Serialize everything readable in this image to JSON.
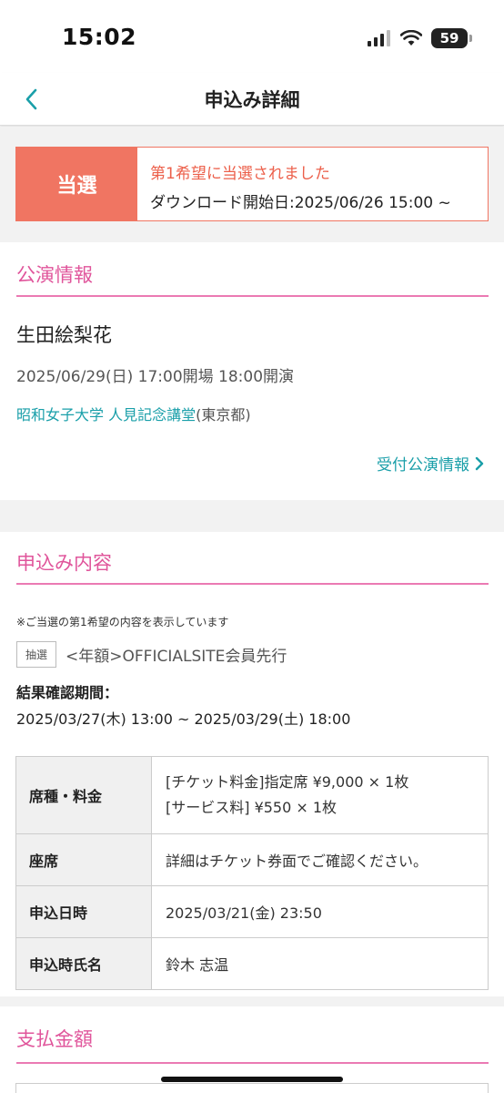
{
  "status_bar": {
    "time": "15:02",
    "battery": "59"
  },
  "nav": {
    "title": "申込み詳細"
  },
  "result": {
    "badge": "当選",
    "headline": "第1希望に当選されました",
    "download": "ダウンロード開始日:2025/06/26 15:00 ~"
  },
  "performance": {
    "section_title": "公演情報",
    "artist": "生田絵梨花",
    "datetime": "2025/06/29(日) 17:00開場 18:00開演",
    "venue": "昭和女子大学 人見記念講堂",
    "prefecture": "(東京都)",
    "more_link": "受付公演情報"
  },
  "application": {
    "section_title": "申込み内容",
    "note": "※ご当選の第1希望の内容を表示しています",
    "tag": "抽選",
    "sale_name": "<年額>OFFICIALSITE会員先行",
    "period_label": "結果確認期間：",
    "period_value": "2025/03/27(木) 13:00 ~ 2025/03/29(土) 18:00",
    "rows": [
      {
        "label": "席種・料金",
        "values": [
          "[チケット料金]指定席 ¥9,000 × 1枚",
          "[サービス料] ¥550 × 1枚"
        ]
      },
      {
        "label": "座席",
        "values": [
          "詳細はチケット券面でご確認ください。"
        ]
      },
      {
        "label": "申込日時",
        "values": [
          "2025/03/21(金) 23:50"
        ]
      },
      {
        "label": "申込時氏名",
        "values": [
          "鈴木 志温"
        ]
      }
    ]
  },
  "payment": {
    "section_title": "支払金額"
  },
  "colors": {
    "accent_pink": "#e0559b",
    "link_teal": "#1a9fa9",
    "winner_red": "#f07562"
  }
}
